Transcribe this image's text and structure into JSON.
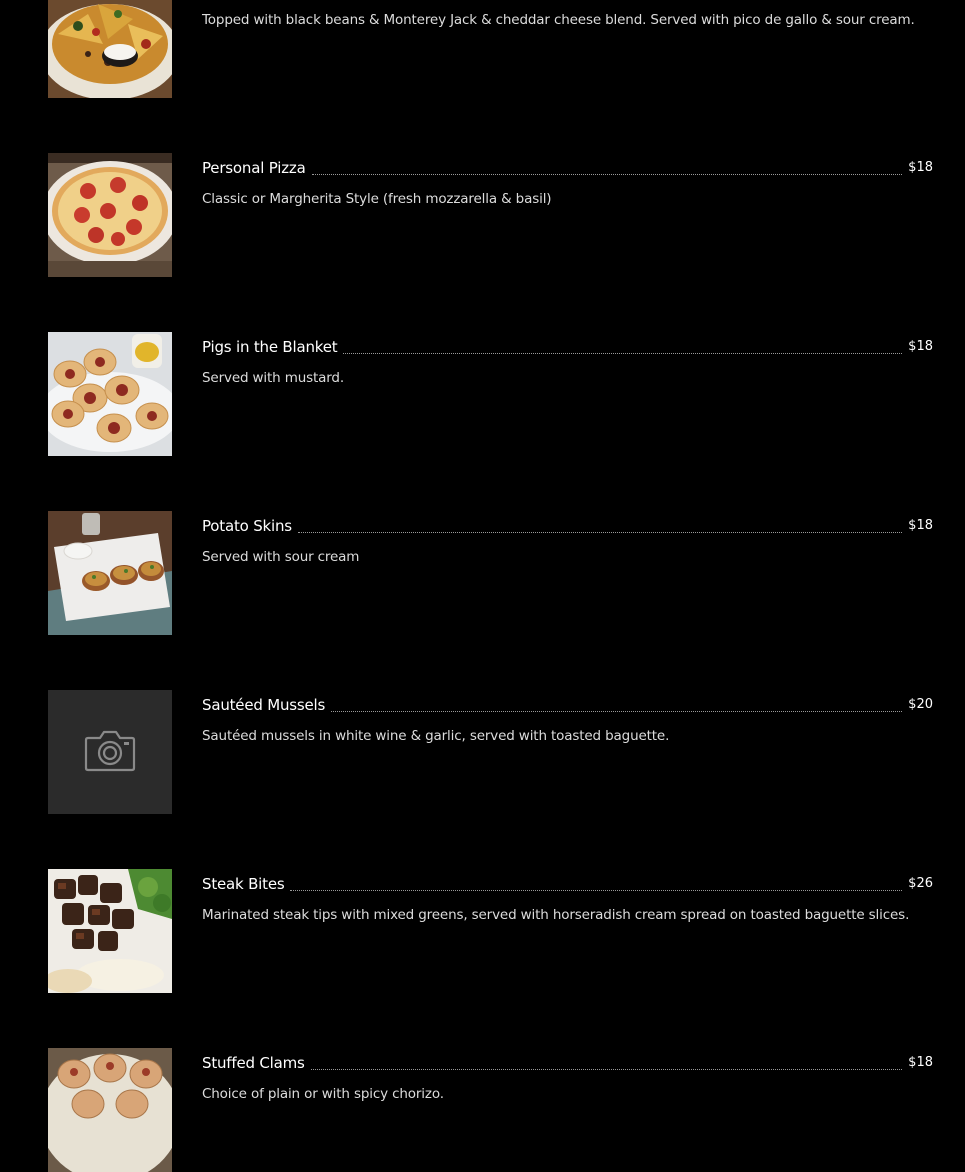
{
  "menu": {
    "items": [
      {
        "name": "",
        "price": "",
        "description": "Topped with black beans & Monterey Jack & cheddar cheese blend. Served with pico de gallo & sour cream.",
        "image": "nachos-photo"
      },
      {
        "name": "Personal Pizza",
        "price": "$18",
        "description": "Classic or Margherita Style (fresh mozzarella & basil)",
        "image": "pizza-photo"
      },
      {
        "name": "Pigs in the Blanket",
        "price": "$18",
        "description": "Served with mustard.",
        "image": "pigs-in-blanket-photo"
      },
      {
        "name": "Potato Skins",
        "price": "$18",
        "description": "Served with sour cream",
        "image": "potato-skins-photo"
      },
      {
        "name": "Sautéed Mussels",
        "price": "$20",
        "description": "Sautéed mussels in white wine & garlic, served with toasted baguette.",
        "image": "camera-placeholder-icon"
      },
      {
        "name": "Steak Bites",
        "price": "$26",
        "description": "Marinated steak tips with mixed greens, served with horseradish cream spread on toasted baguette slices.",
        "image": "steak-bites-photo"
      },
      {
        "name": "Stuffed Clams",
        "price": "$18",
        "description": "Choice of plain or with spicy chorizo.",
        "image": "stuffed-clams-photo"
      }
    ]
  },
  "colors": {
    "background": "#000000",
    "text": "#ffffff",
    "description_text": "#dcdcdc",
    "dot_leader": "#9a9a9a",
    "placeholder_bg": "#2b2b2b",
    "placeholder_icon": "#8a8a8a"
  }
}
